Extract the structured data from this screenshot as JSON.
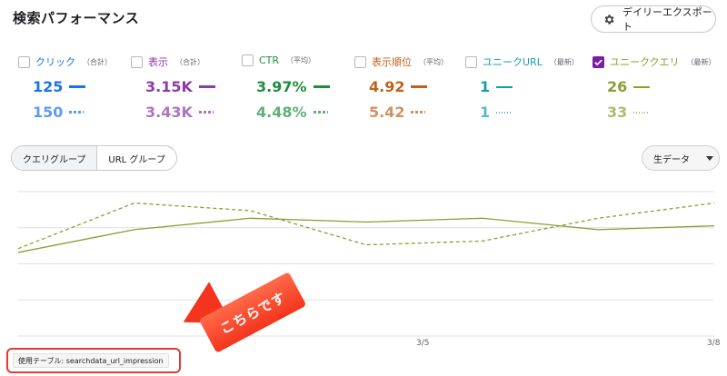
{
  "header": {
    "title": "検索パフォーマンス",
    "export_label": "デイリーエクスポート"
  },
  "metrics": [
    {
      "label": "クリック",
      "sub": "（合計）",
      "color": "#1a73e8",
      "checked": false,
      "value1": "125",
      "value2": "150"
    },
    {
      "label": "表示",
      "sub": "（合計）",
      "color": "#8e3aa8",
      "checked": false,
      "value1": "3.15K",
      "value2": "3.43K"
    },
    {
      "label": "CTR",
      "sub": "（平均）",
      "color": "#1e8e3e",
      "checked": false,
      "value1": "3.97%",
      "value2": "4.48%"
    },
    {
      "label": "表示順位",
      "sub": "（平均）",
      "color": "#c0621b",
      "checked": false,
      "value1": "4.92",
      "value2": "5.42"
    },
    {
      "label": "ユニークURL",
      "sub": "（最新）",
      "color": "#129eaf",
      "checked": false,
      "value1": "1",
      "value2": "1"
    },
    {
      "label": "ユニーククエリ",
      "sub": "（最新）",
      "color": "#8d9d32",
      "checked": true,
      "value1": "26",
      "value2": "33"
    }
  ],
  "tabs": {
    "query_group": "クエリグループ",
    "url_group": "URL グループ"
  },
  "raw_data": {
    "label": "生データ"
  },
  "chart_data": {
    "type": "line",
    "x": [
      "",
      "",
      "",
      "",
      "",
      "",
      "",
      "",
      "",
      "",
      "",
      "",
      "",
      "",
      "",
      "",
      ""
    ],
    "x_tick_labels": [
      "3/5",
      "3/8"
    ],
    "series": [
      {
        "values": [
          22,
          28,
          31,
          30,
          31,
          28,
          29
        ]
      },
      {
        "values": [
          23,
          35,
          33,
          24,
          25,
          31,
          35
        ]
      }
    ],
    "ylim": [
      0,
      38
    ],
    "grid": true
  },
  "callout": {
    "text": "こちらです"
  },
  "table_label": {
    "text": "使用テーブル: searchdata_url_impression"
  }
}
